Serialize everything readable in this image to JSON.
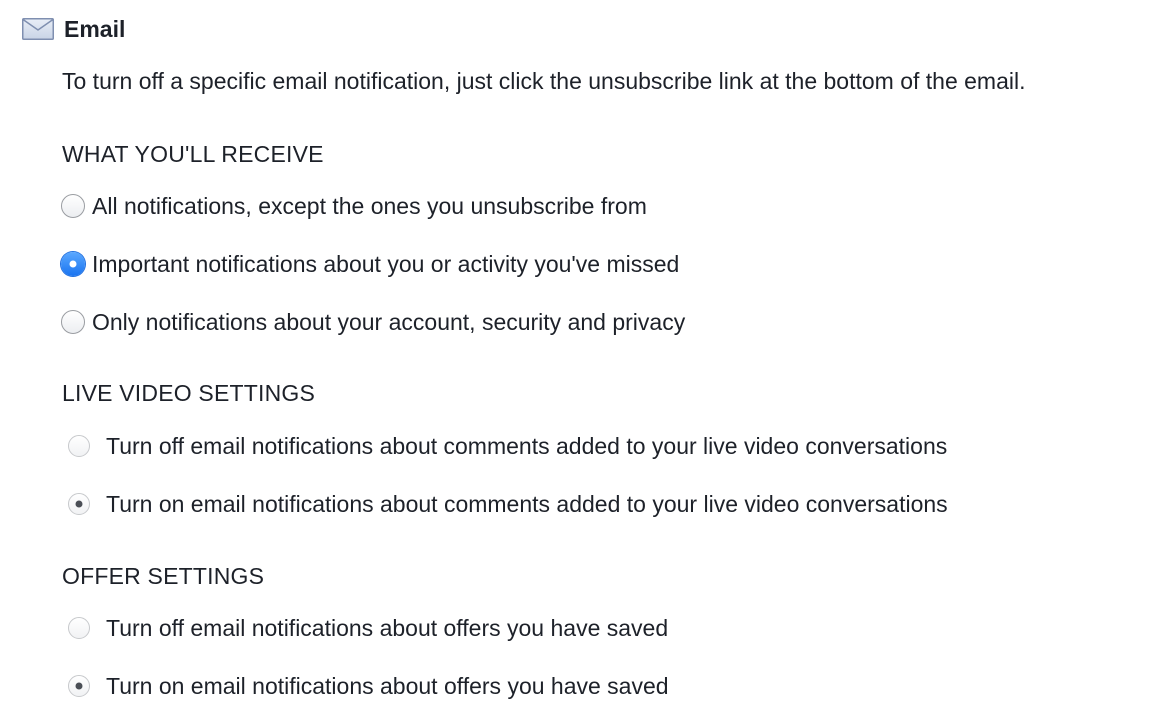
{
  "section": {
    "icon": "mail-icon",
    "title": "Email",
    "intro": "To turn off a specific email notification, just click the unsubscribe link at the bottom of the email."
  },
  "groups": [
    {
      "heading": "WHAT YOU'LL RECEIVE",
      "options": [
        {
          "label": "All notifications, except the ones you unsubscribe from",
          "selected": false
        },
        {
          "label": "Important notifications about you or activity you've missed",
          "selected": true
        },
        {
          "label": "Only notifications about your account, security and privacy",
          "selected": false
        }
      ]
    },
    {
      "heading": "LIVE VIDEO SETTINGS",
      "options": [
        {
          "label": "Turn off email notifications about comments added to your live video conversations",
          "selected": false
        },
        {
          "label": "Turn on email notifications about comments added to your live video conversations",
          "selected": true
        }
      ]
    },
    {
      "heading": "OFFER SETTINGS",
      "options": [
        {
          "label": "Turn off email notifications about offers you have saved",
          "selected": false
        },
        {
          "label": "Turn on email notifications about offers you have saved",
          "selected": true
        }
      ]
    }
  ],
  "colors": {
    "accent": "#1877f2",
    "text": "#1d2129"
  }
}
